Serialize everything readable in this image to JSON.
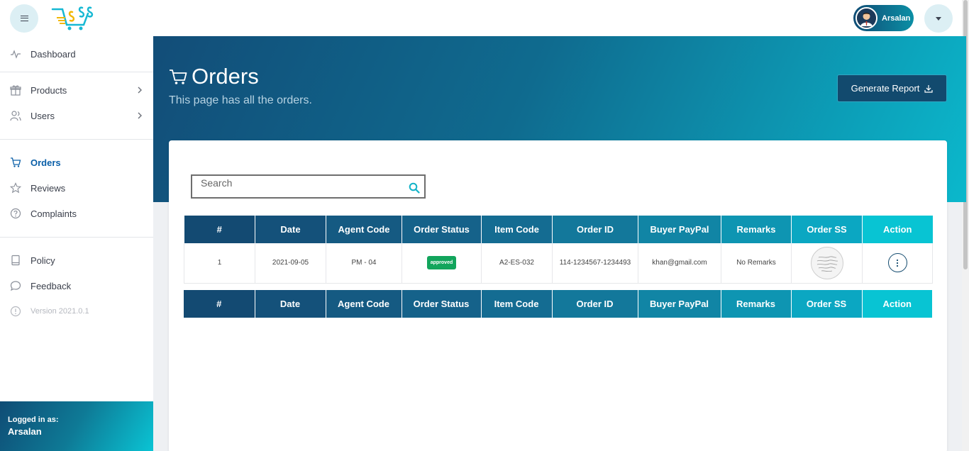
{
  "topbar": {
    "user_name": "Arsalan"
  },
  "sidebar": {
    "items": [
      {
        "label": "Dashboard",
        "icon": "activity-icon"
      },
      {
        "label": "Products",
        "icon": "gift-icon"
      },
      {
        "label": "Users",
        "icon": "users-icon"
      },
      {
        "label": "Orders",
        "icon": "cart-icon"
      },
      {
        "label": "Reviews",
        "icon": "star-icon"
      },
      {
        "label": "Complaints",
        "icon": "help-circle-icon"
      },
      {
        "label": "Policy",
        "icon": "book-icon"
      },
      {
        "label": "Feedback",
        "icon": "chat-icon"
      },
      {
        "label": "Version 2021.0.1",
        "icon": "info-icon"
      }
    ],
    "logged_in_label": "Logged in as:",
    "logged_in_user": "Arsalan"
  },
  "page": {
    "title": "Orders",
    "subtitle": "This page has all the orders.",
    "generate_report_label": "Generate Report"
  },
  "search": {
    "placeholder": "Search"
  },
  "table": {
    "columns": [
      "#",
      "Date",
      "Agent Code",
      "Order Status",
      "Item Code",
      "Order ID",
      "Buyer PayPal",
      "Remarks",
      "Order SS",
      "Action"
    ],
    "rows": [
      {
        "num": "1",
        "date": "2021-09-05",
        "agent_code": "PM - 04",
        "order_status": "approved",
        "item_code": "A2-ES-032",
        "order_id": "114-1234567-1234493",
        "buyer_paypal": "khan@gmail.com",
        "remarks": "No Remarks"
      }
    ]
  },
  "colors": {
    "header_dark": "#124d78",
    "header_light": "#0ac4d4",
    "active_nav": "#0a5fa8",
    "status_approved": "#12a55c"
  }
}
